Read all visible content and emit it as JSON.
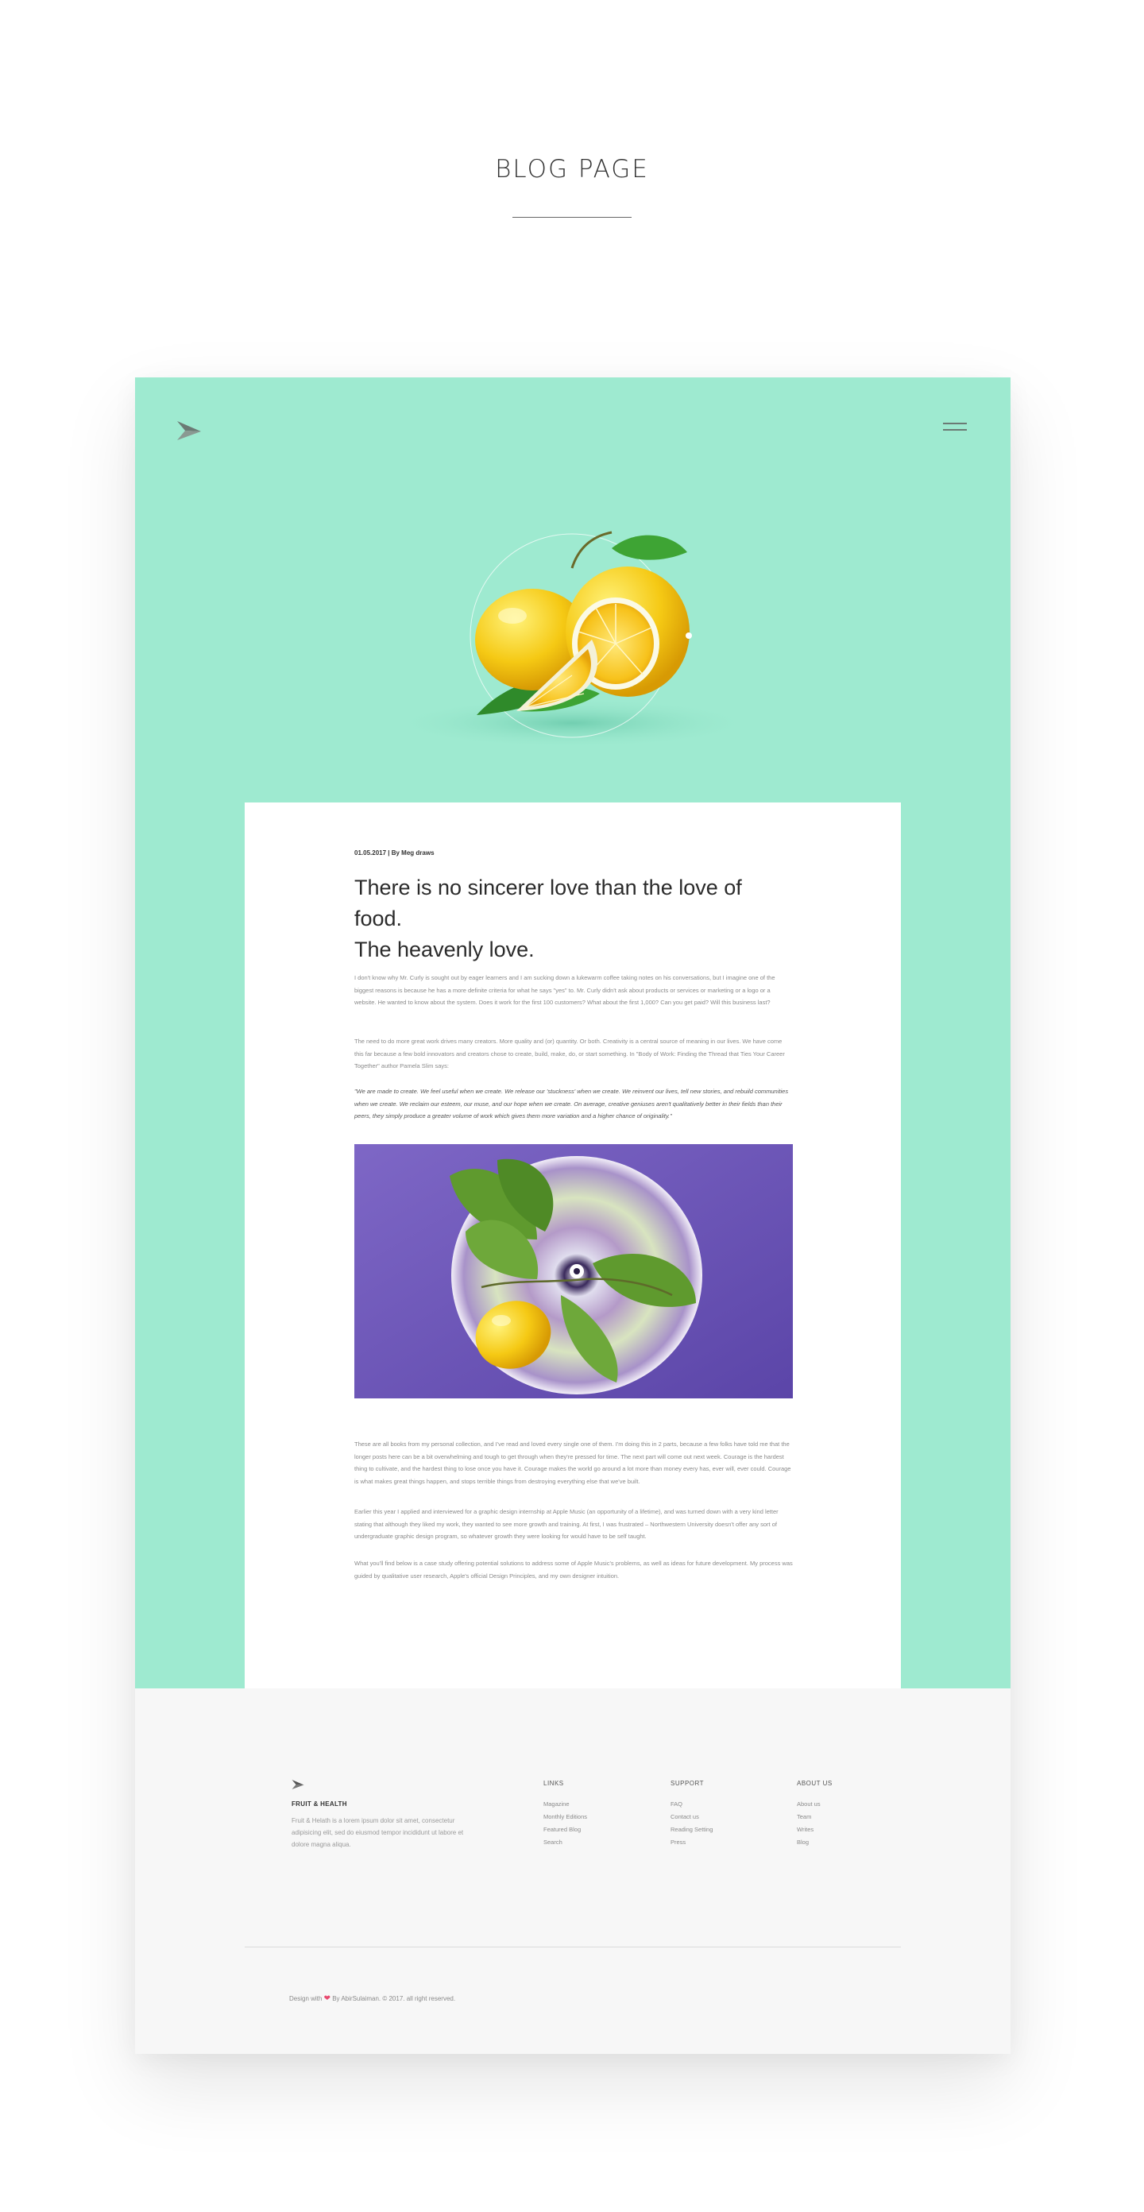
{
  "page": {
    "title": "BLOG PAGE"
  },
  "header": {
    "logo_icon": "paper-plane-logo-icon",
    "menu_icon": "hamburger-menu-icon",
    "accent_color": "#9eead0"
  },
  "article": {
    "meta": "01.05.2017 | By Meg draws",
    "headline_line1": "There is no sincerer love than the love of food.",
    "headline_line2": "The heavenly love.",
    "paragraphs": [
      "I don't know why Mr. Curly is sought out by eager learners and I am sucking down a lukewarm coffee taking notes on his conversations, but I imagine one of the biggest reasons is because he has a more definite criteria for what he says \"yes\" to. Mr. Curly didn't ask about products or services or marketing or a logo or a website. He wanted to know about the system. Does it work for the first 100 customers? What about the first 1,000? Can you get paid? Will this business last?",
      "The need to do more great work drives many creators. More quality and (or) quantity. Or both. Creativity is a central source of meaning in our lives. We have come this far because a few bold innovators and creators chose to create, build, make, do, or start something. In \"Body of Work: Finding the Thread that Ties Your Career Together\" author Pamela Slim says:",
      "\"We are made to create. We feel useful when we create. We release our 'stuckness' when we create. We reinvent our lives, tell new stories, and rebuild communities when we create. We reclaim our esteem, our muse, and our hope when we create. On average, creative geniuses aren't qualitatively better in their fields than their peers, they simply produce a greater volume of work which gives them more variation and a higher chance of originality.\"",
      "These are all books from my personal collection, and I've read and loved every single one of them. I'm doing this in 2 parts, because a few folks have told me that the longer posts here can be a bit overwhelming and tough to get through when they're pressed for time. The next part will come out next week. Courage is the hardest thing to cultivate, and the hardest thing to lose once you have it. Courage makes the world go around a lot more than money every has, ever will, ever could. Courage is what makes great things happen, and stops terrible things from destroying everything else that we've built.",
      "Earlier this year I applied and interviewed for a graphic design internship at Apple Music (an opportunity of a lifetime), and was turned down with a very kind letter stating that although they liked my work, they wanted to see more growth and training. At first, I was frustrated – Northwestern University doesn't offer any sort of undergraduate graphic design program, so whatever growth they were looking for would have to be self taught.",
      "What you'll find below is a case study offering potential solutions to address some of Apple Music's problems, as well as ideas for future development. My process was guided by qualitative user research, Apple's official Design Principles, and my own designer intuition."
    ]
  },
  "footer": {
    "brand": "FRUIT & HEALTH",
    "description": "Fruit & Helath  is a lorem ipsum dolor sit amet, consectetur adipisicing elit, sed do eiusmod tempor incididunt ut labore et dolore magna aliqua.",
    "columns": [
      {
        "heading": "LINKS",
        "items": [
          "Magazine",
          "Monthly Editions",
          "Featured Blog",
          "Search"
        ]
      },
      {
        "heading": "SUPPORT",
        "items": [
          "FAQ",
          "Contact us",
          "Reading Setting",
          "Press"
        ]
      },
      {
        "heading": "ABOUT US",
        "items": [
          "About us",
          "Team",
          "Writes",
          "Blog"
        ]
      }
    ],
    "credit_prefix": "Design with",
    "heart_icon": "heart-icon",
    "credit_suffix": "By AbirSulaiman. © 2017. all right reserved."
  }
}
